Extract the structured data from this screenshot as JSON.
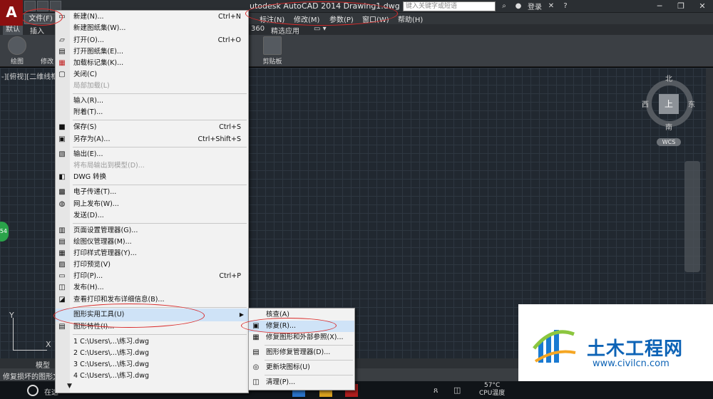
{
  "window": {
    "title": "utodesk AutoCAD 2014    Drawing1.dwg",
    "search_placeholder": "键入关键字或短语",
    "login": "登录",
    "app_logo": "A"
  },
  "menubar": {
    "file": "文件(F)",
    "items": [
      "标注(N)",
      "修改(M)",
      "参数(P)",
      "窗口(W)",
      "帮助(H)"
    ]
  },
  "ribbon": {
    "tabs": [
      "默认",
      "插入",
      "360",
      "精选应用"
    ],
    "draw_label": "绘图",
    "modify_label": "修改",
    "clipboard_label": "剪贴板"
  },
  "viewport": {
    "label": "-][俯视][二维线框",
    "viewcube": {
      "north": "北",
      "south": "南",
      "west": "西",
      "east": "东",
      "top": "上",
      "wcs": "WCS"
    },
    "ucs": {
      "x": "X",
      "y": "Y"
    },
    "green_badge": "54"
  },
  "bottom": {
    "model_tab": "模型",
    "command_text": "修复损坏的图形文件"
  },
  "taskbar": {
    "search_text": "在这",
    "temp": "57°C",
    "temp_label": "CPU温度"
  },
  "file_menu": {
    "items": [
      {
        "icon": "▭",
        "label": "新建(N)...",
        "shortcut": "Ctrl+N"
      },
      {
        "icon": "",
        "label": "新建图纸集(W)...",
        "shortcut": ""
      },
      {
        "icon": "▱",
        "label": "打开(O)...",
        "shortcut": "Ctrl+O"
      },
      {
        "icon": "▤",
        "label": "打开图纸集(E)...",
        "shortcut": ""
      },
      {
        "icon": "▦",
        "label": "加载标记集(K)...",
        "shortcut": ""
      },
      {
        "icon": "▢",
        "label": "关闭(C)",
        "shortcut": ""
      },
      {
        "icon": "",
        "label": "局部加载(L)",
        "shortcut": "",
        "disabled": true
      },
      {
        "icon": "",
        "label": "输入(R)...",
        "shortcut": ""
      },
      {
        "icon": "",
        "label": "附着(T)...",
        "shortcut": ""
      },
      {
        "icon": "■",
        "label": "保存(S)",
        "shortcut": "Ctrl+S"
      },
      {
        "icon": "▣",
        "label": "另存为(A)...",
        "shortcut": "Ctrl+Shift+S"
      },
      {
        "icon": "▧",
        "label": "输出(E)...",
        "shortcut": ""
      },
      {
        "icon": "",
        "label": "将布局输出到模型(D)...",
        "shortcut": "",
        "disabled": true
      },
      {
        "icon": "◧",
        "label": "DWG 转换",
        "shortcut": ""
      },
      {
        "icon": "▩",
        "label": "电子传递(T)...",
        "shortcut": ""
      },
      {
        "icon": "◍",
        "label": "网上发布(W)...",
        "shortcut": ""
      },
      {
        "icon": "",
        "label": "发送(D)...",
        "shortcut": ""
      },
      {
        "icon": "▥",
        "label": "页面设置管理器(G)...",
        "shortcut": ""
      },
      {
        "icon": "▤",
        "label": "绘图仪管理器(M)...",
        "shortcut": ""
      },
      {
        "icon": "▦",
        "label": "打印样式管理器(Y)...",
        "shortcut": ""
      },
      {
        "icon": "▨",
        "label": "打印预览(V)",
        "shortcut": ""
      },
      {
        "icon": "▭",
        "label": "打印(P)...",
        "shortcut": "Ctrl+P"
      },
      {
        "icon": "◫",
        "label": "发布(H)...",
        "shortcut": ""
      },
      {
        "icon": "◪",
        "label": "查看打印和发布详细信息(B)...",
        "shortcut": ""
      },
      {
        "icon": "",
        "label": "图形实用工具(U)",
        "shortcut": "",
        "submenu": true
      },
      {
        "icon": "▤",
        "label": "图形特性(I)...",
        "shortcut": ""
      },
      {
        "icon": "",
        "label": "1 C:\\Users\\...\\练习.dwg",
        "shortcut": ""
      },
      {
        "icon": "",
        "label": "2 C:\\Users\\...\\练习.dwg",
        "shortcut": ""
      },
      {
        "icon": "",
        "label": "3 C:\\Users\\...\\练习.dwg",
        "shortcut": ""
      },
      {
        "icon": "",
        "label": "4 C:\\Users\\...\\练习.dwg",
        "shortcut": ""
      }
    ],
    "more": "▼"
  },
  "submenu": {
    "items": [
      {
        "icon": "",
        "label": "核查(A)"
      },
      {
        "icon": "▣",
        "label": "修复(R)..."
      },
      {
        "icon": "▦",
        "label": "修复图形和外部参照(X)..."
      },
      {
        "icon": "▤",
        "label": "图形修复管理器(D)..."
      },
      {
        "icon": "◎",
        "label": "更新块图标(U)"
      },
      {
        "icon": "◫",
        "label": "清理(P)..."
      }
    ]
  },
  "watermark": {
    "title": "土木工程网",
    "url": "www.civilcn.com"
  },
  "colors": {
    "annotation": "#d92b2b",
    "highlight": "#cfe3f7",
    "brand_blue": "#0d63b6"
  }
}
